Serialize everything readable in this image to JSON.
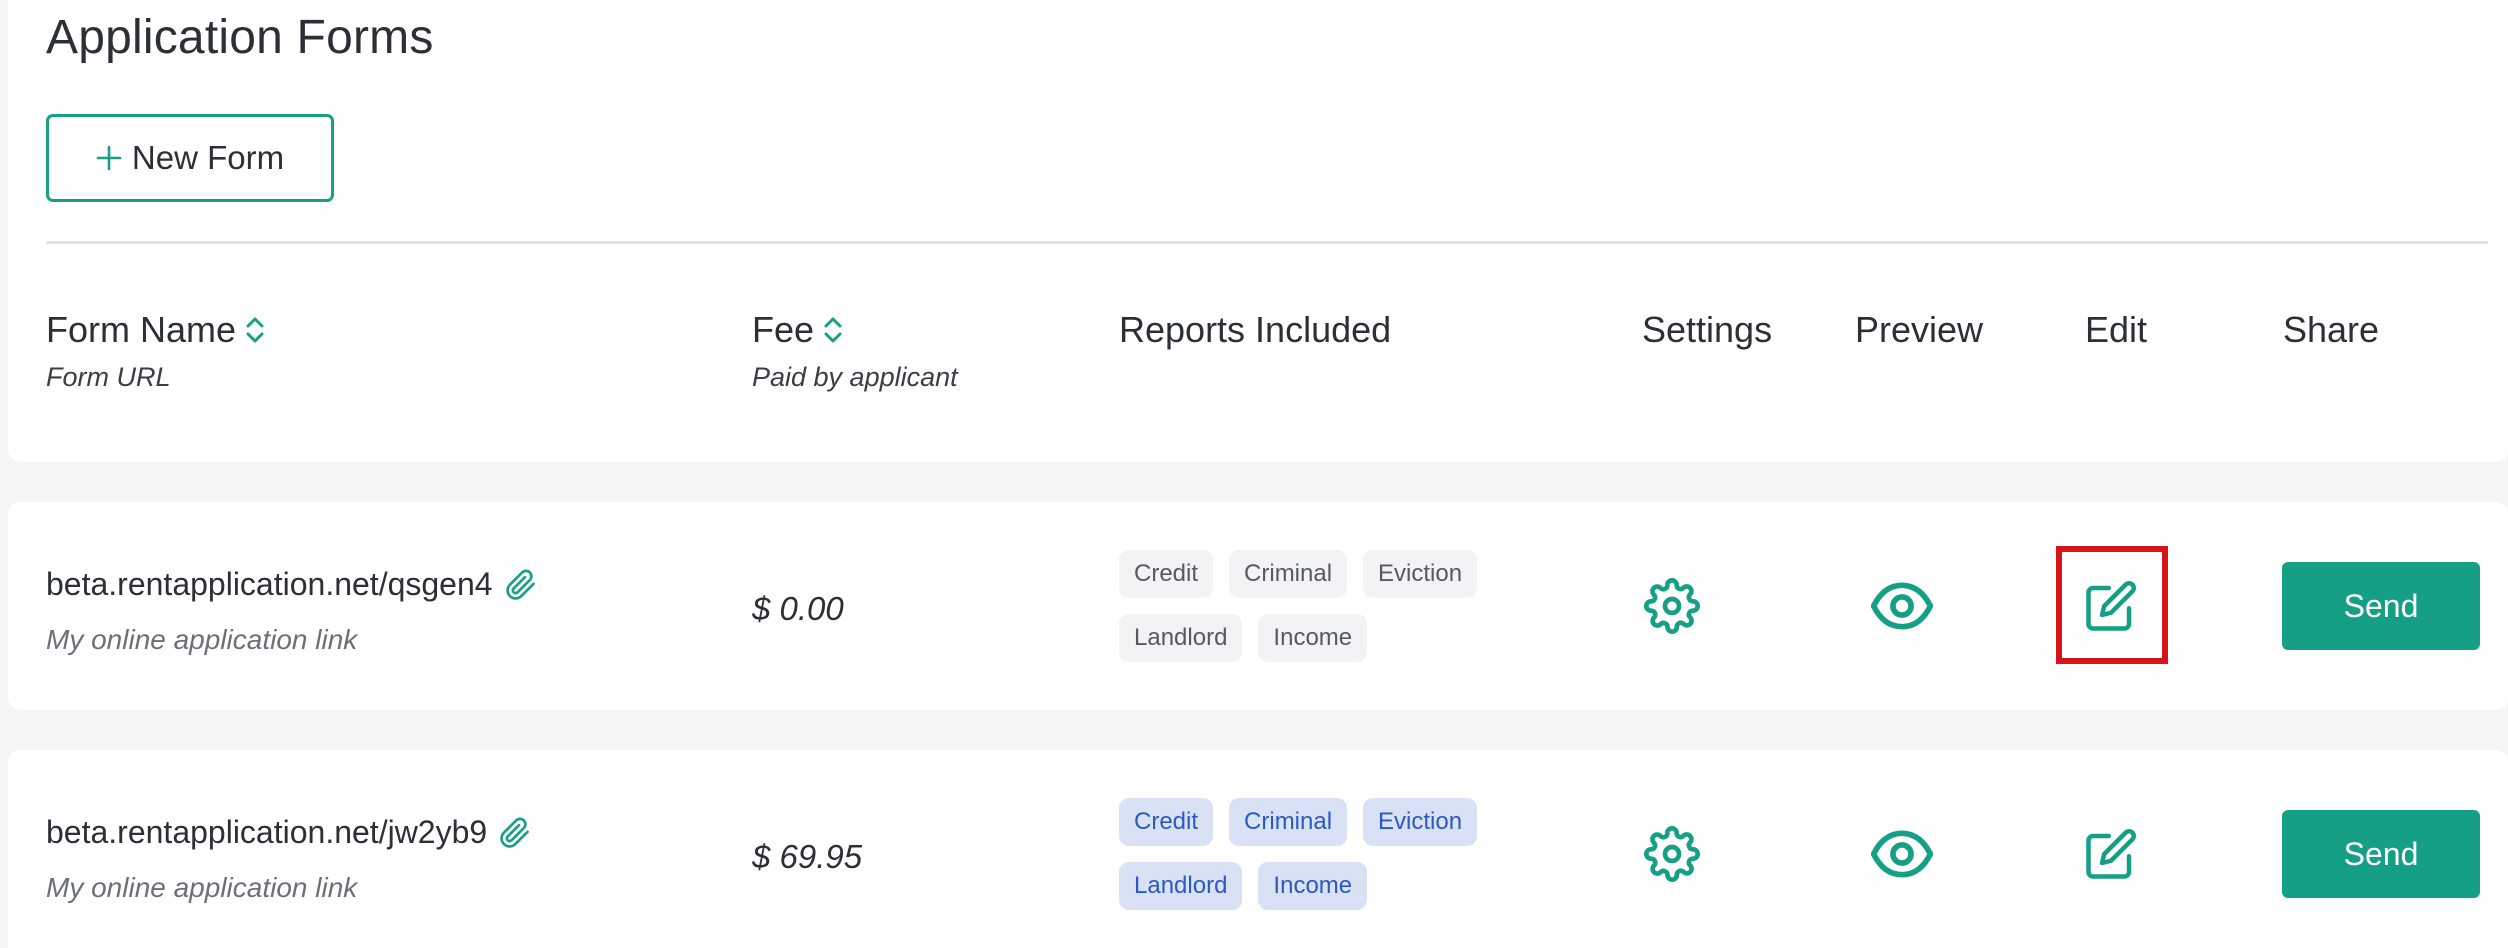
{
  "page": {
    "title": "Application Forms",
    "new_form_label": "New Form",
    "accent_color": "#15a085"
  },
  "columns": {
    "form_name": "Form Name",
    "form_url": "Form URL",
    "fee": "Fee",
    "fee_sub": "Paid by applicant",
    "reports": "Reports Included",
    "settings": "Settings",
    "preview": "Preview",
    "edit": "Edit",
    "share": "Share"
  },
  "rows": [
    {
      "url": "beta.rentapplication.net/qsgen4",
      "description": "My online application link",
      "fee": "$ 0.00",
      "reports": [
        "Credit",
        "Criminal",
        "Eviction",
        "Landlord",
        "Income"
      ],
      "reports_active": false,
      "send_label": "Send",
      "edit_highlighted": true
    },
    {
      "url": "beta.rentapplication.net/jw2yb9",
      "description": "My online application link",
      "fee": "$ 69.95",
      "reports": [
        "Credit",
        "Criminal",
        "Eviction",
        "Landlord",
        "Income"
      ],
      "reports_active": true,
      "send_label": "Send",
      "edit_highlighted": false
    }
  ]
}
